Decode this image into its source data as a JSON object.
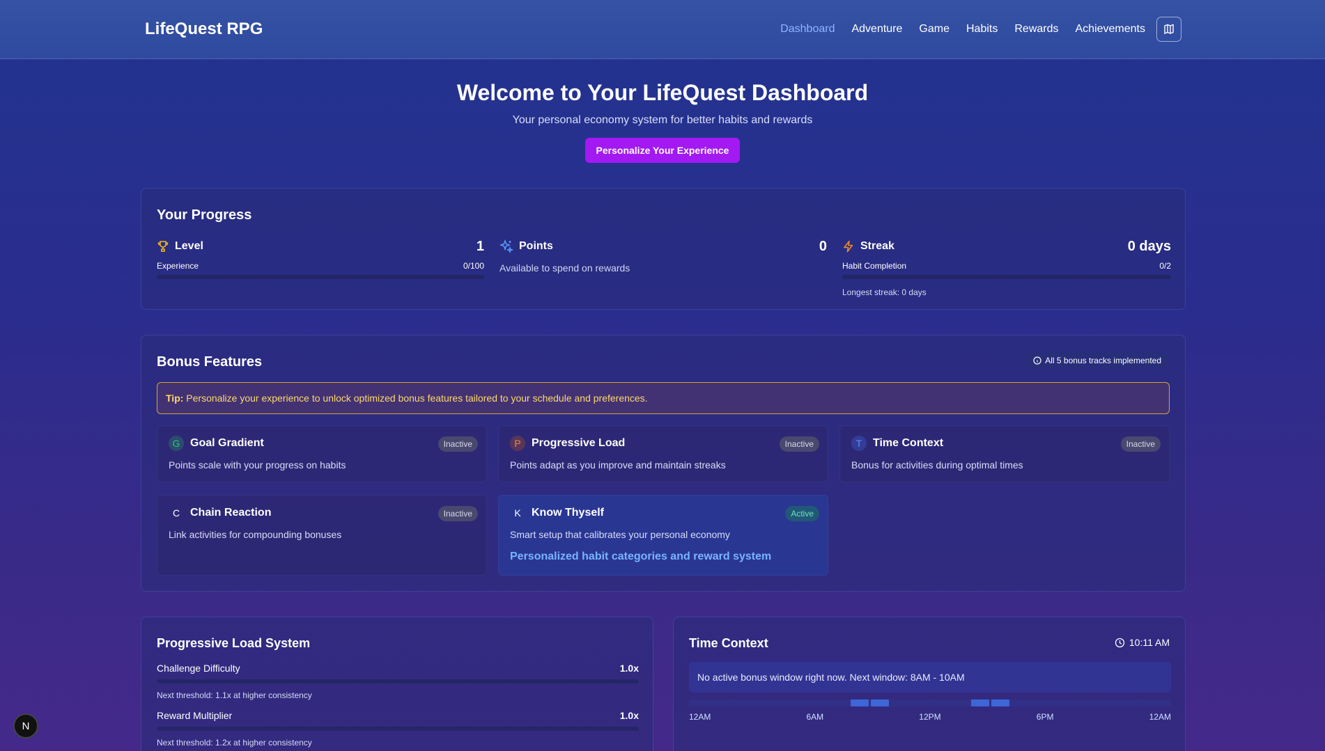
{
  "nav": {
    "brand": "LifeQuest RPG",
    "links": [
      "Dashboard",
      "Adventure",
      "Game",
      "Habits",
      "Rewards",
      "Achievements"
    ],
    "active": "Dashboard",
    "menu_icon": "book-map-icon"
  },
  "hero": {
    "title": "Welcome to Your LifeQuest Dashboard",
    "subtitle": "Your personal economy system for better habits and rewards",
    "cta": "Personalize Your Experience"
  },
  "progress": {
    "title": "Your Progress",
    "level": {
      "label": "Level",
      "value": "1",
      "bar_label": "Experience",
      "bar_value": "0/100",
      "fill": 0
    },
    "points": {
      "label": "Points",
      "value": "0",
      "desc": "Available to spend on rewards"
    },
    "streak": {
      "label": "Streak",
      "value": "0 days",
      "bar_label": "Habit Completion",
      "bar_value": "0/2",
      "fill": 0,
      "longest": "Longest streak: 0 days"
    }
  },
  "bonus": {
    "title": "Bonus Features",
    "badge": "All 5 bonus tracks implemented",
    "tip_prefix": "Tip:",
    "tip_text": "Personalize your experience to unlock optimized bonus features tailored to your schedule and preferences.",
    "features": [
      {
        "letter": "G",
        "title": "Goal Gradient",
        "desc": "Points scale with your progress on habits",
        "status": "Inactive",
        "color": "#32c07f"
      },
      {
        "letter": "P",
        "title": "Progressive Load",
        "desc": "Points adapt as you improve and maintain streaks",
        "status": "Inactive",
        "color": "#f08a3a"
      },
      {
        "letter": "T",
        "title": "Time Context",
        "desc": "Bonus for activities during optimal times",
        "status": "Inactive",
        "color": "#5a8dff"
      },
      {
        "letter": "C",
        "title": "Chain Reaction",
        "desc": "Link activities for compounding bonuses",
        "status": "Inactive",
        "color": "#ffffff"
      },
      {
        "letter": "K",
        "title": "Know Thyself",
        "desc": "Smart setup that calibrates your personal economy",
        "status": "Active",
        "color": "#ffffff",
        "link": "Personalized habit categories and reward system"
      }
    ]
  },
  "load": {
    "title": "Progressive Load System",
    "rows": [
      {
        "label": "Challenge Difficulty",
        "value": "1.0x",
        "hint": "Next threshold: 1.1x at higher consistency",
        "fill": 0
      },
      {
        "label": "Reward Multiplier",
        "value": "1.0x",
        "hint": "Next threshold: 1.2x at higher consistency",
        "fill": 0
      }
    ]
  },
  "time": {
    "title": "Time Context",
    "clock": "10:11 AM",
    "message": "No active bonus window right now. Next window: 8AM - 10AM",
    "labels": [
      "12AM",
      "6AM",
      "12PM",
      "6PM",
      "12AM"
    ],
    "windows": [
      [
        8,
        10
      ],
      [
        14,
        16
      ]
    ]
  },
  "dev_badge": "N"
}
